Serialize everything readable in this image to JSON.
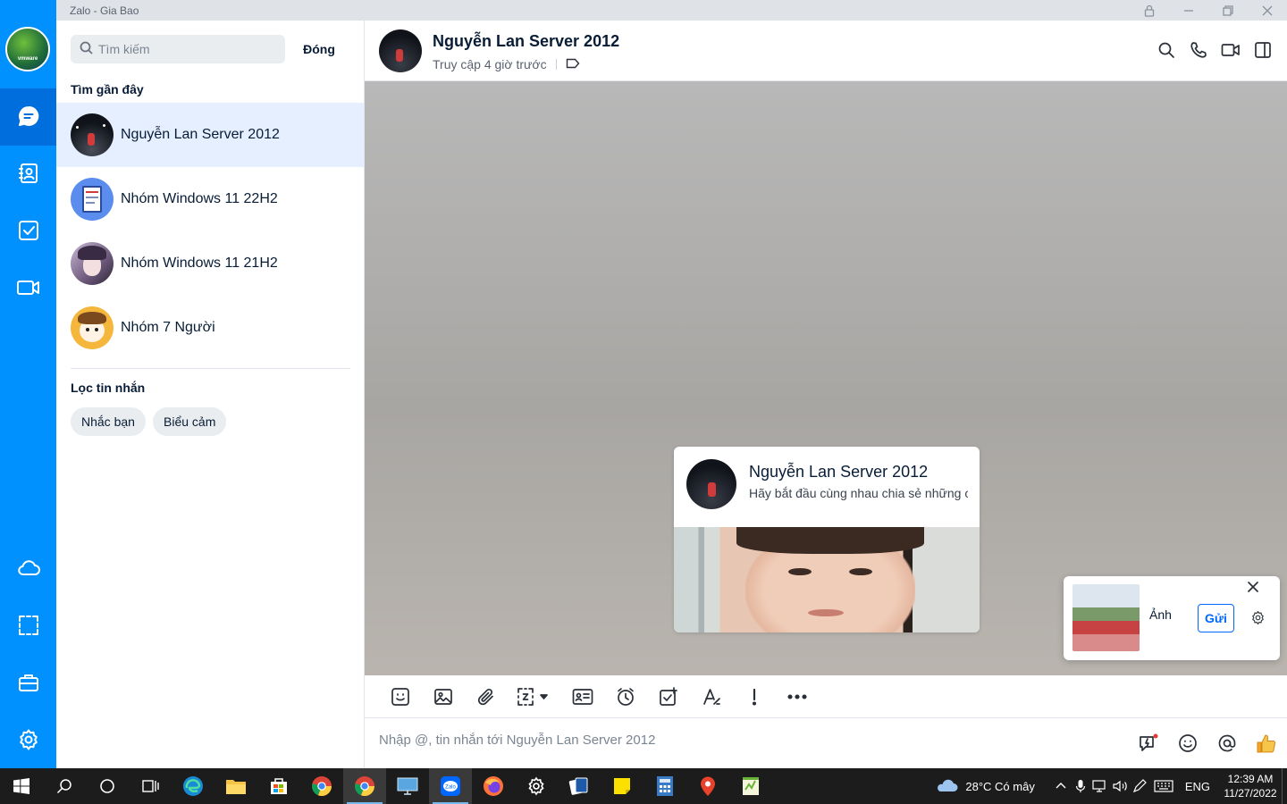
{
  "window": {
    "title": "Zalo - Gia Bao"
  },
  "rail": {
    "avatar_text": "vmware",
    "nav": [
      "messages",
      "contacts",
      "todo",
      "video-meeting",
      "cloud",
      "screenshot",
      "toolbox",
      "settings"
    ]
  },
  "search": {
    "placeholder": "Tìm kiếm",
    "close_label": "Đóng",
    "recent_label": "Tìm gần đây",
    "recent": [
      {
        "name": "Nguyễn Lan Server 2012",
        "active": true
      },
      {
        "name": "Nhóm Windows 11 22H2",
        "active": false
      },
      {
        "name": "Nhóm Windows 11 21H2",
        "active": false
      },
      {
        "name": "Nhóm 7 Người",
        "active": false
      }
    ],
    "filter_label": "Lọc tin nhắn",
    "filters": [
      "Nhắc bạn",
      "Biểu cảm"
    ]
  },
  "chat": {
    "name": "Nguyễn Lan Server 2012",
    "status": "Truy cập 4 giờ trước",
    "intro_card": {
      "name": "Nguyễn Lan Server 2012",
      "message": "Hãy bắt đầu cùng nhau chia sẻ những câu chuyện thú vị"
    },
    "photo_popup": {
      "label": "Ảnh",
      "send_label": "Gửi"
    },
    "composer_placeholder": "Nhập @, tin nhắn tới Nguyễn Lan Server 2012"
  },
  "taskbar": {
    "weather": "28°C  Có mây",
    "lang": "ENG",
    "time": "12:39 AM",
    "date": "11/27/2022"
  },
  "colors": {
    "rail": "#0091ff",
    "rail_active": "#006edc",
    "selected_row": "#e5efff",
    "accent": "#0068ff"
  }
}
